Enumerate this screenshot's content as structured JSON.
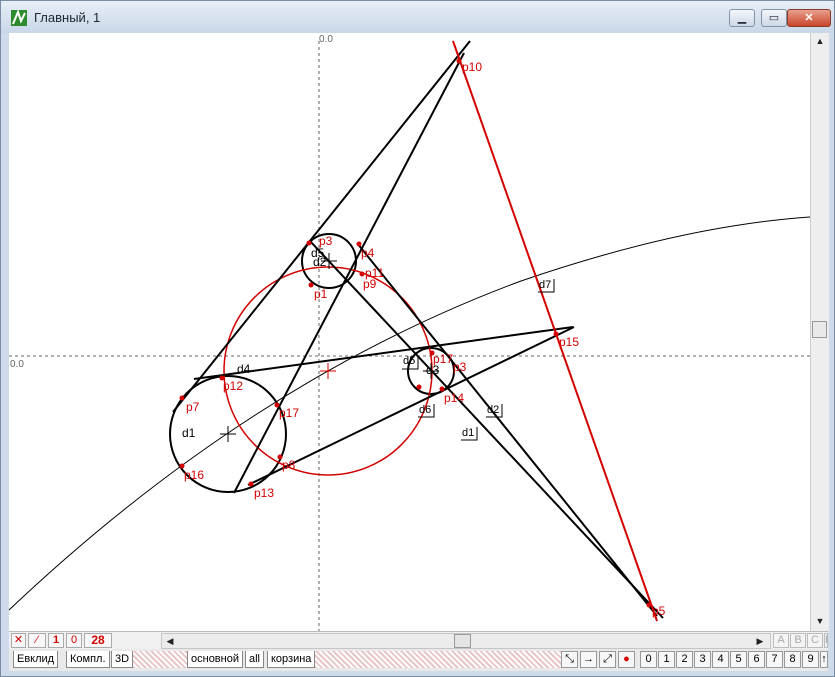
{
  "window": {
    "title": "Главный, 1",
    "minimize_icon": "minimize-icon",
    "restore_icon": "restore-icon",
    "close_icon": "close-icon"
  },
  "axes": {
    "origin_top": "0.0",
    "origin_left": "0.0"
  },
  "points": [
    "p1",
    "p3",
    "p4",
    "p5",
    "p6",
    "p7",
    "p8",
    "p9",
    "p10",
    "p11",
    "p12",
    "p13",
    "p14",
    "p15",
    "p16",
    "p17"
  ],
  "labels": {
    "d1": "d1",
    "d2": "d2",
    "d3": "d3",
    "d4": "d4",
    "d5": "d5",
    "d6": "d6",
    "d7": "d7",
    "b1": "d1",
    "b2": "d2",
    "b3": "d3",
    "b4": "d4",
    "b5": "d5",
    "b6": "d6",
    "b7": "d7",
    "b8": "d8",
    "b9": "d9"
  },
  "toolbar": {
    "counter_1": "1",
    "counter_0": "0",
    "count": "28",
    "abcd": [
      "A",
      "B",
      "C",
      "D"
    ]
  },
  "tabs": {
    "left": [
      "Евклид",
      "Компл.",
      "3D"
    ],
    "layers": [
      "основной",
      "all",
      "корзина"
    ]
  },
  "number_buttons": [
    "0",
    "1",
    "2",
    "3",
    "4",
    "5",
    "6",
    "7",
    "8",
    "9"
  ],
  "up_arrow": "↑",
  "colors": {
    "construction": "#d40000",
    "lines": "#000000",
    "axes": "#555555"
  }
}
